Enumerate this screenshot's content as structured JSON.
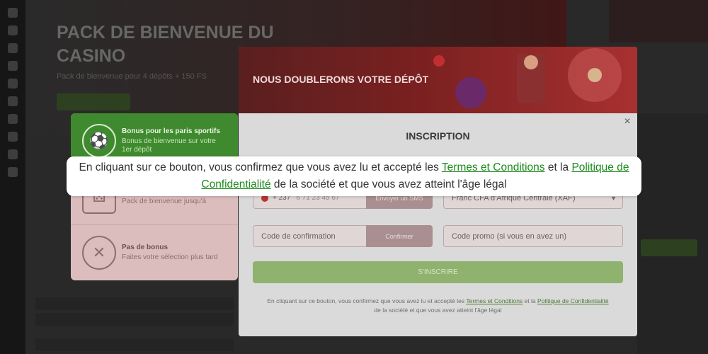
{
  "hero": {
    "title": "PACK DE BIENVENUE DU CASINO",
    "subtitle": "Pack de bienvenue pour 4 dépôts + 150 FS"
  },
  "bonus_options": [
    {
      "title": "Bonus pour les paris sportifs",
      "desc": "Bonus de bienvenue sur votre 1er dépôt",
      "icon": "soccer-ball-icon",
      "selected": true
    },
    {
      "title": "",
      "desc": "Pack de bienvenue jusqu'à",
      "icon": "casino-dice-icon",
      "selected": false
    },
    {
      "title": "Pas de bonus",
      "desc": "Faites votre sélection plus tard",
      "icon": "no-bonus-x-icon",
      "selected": false
    }
  ],
  "modal": {
    "banner_title": "NOUS DOUBLERONS VOTRE DÉPÔT",
    "heading": "INSCRIPTION",
    "close": "×",
    "phone": {
      "code": "+ 237",
      "placeholder": "6 71 23 45 67",
      "send_sms": "Envoyer un SMS"
    },
    "currency": "Franc CFA d'Afrique Centrale (XAF)",
    "confirmation_code": "Code de confirmation",
    "confirm_button": "Confirmer",
    "promo_code": "Code promo (si vous en avez un)",
    "submit": "S'INSCRIRE",
    "legal": {
      "part1": "En cliquant sur ce bouton, vous confirmez que vous avez lu et accepté les ",
      "terms": "Termes et Conditions",
      "part2": " et la ",
      "privacy": "Politique de Confidentialité",
      "part3": " de la société et que vous avez atteint l'âge légal"
    }
  },
  "callout": {
    "part1": "En cliquant sur ce bouton, vous confirmez que vous avez lu et accepté les ",
    "terms": "Termes et Conditions",
    "part2": " et la ",
    "privacy": "Politique de Confidentialité",
    "part3": " de la société et que vous avez atteint l'âge légal"
  },
  "colors": {
    "accent": "#1d8a1d",
    "selected_bonus": "#3f8a2e",
    "banner": "#7a2020"
  }
}
